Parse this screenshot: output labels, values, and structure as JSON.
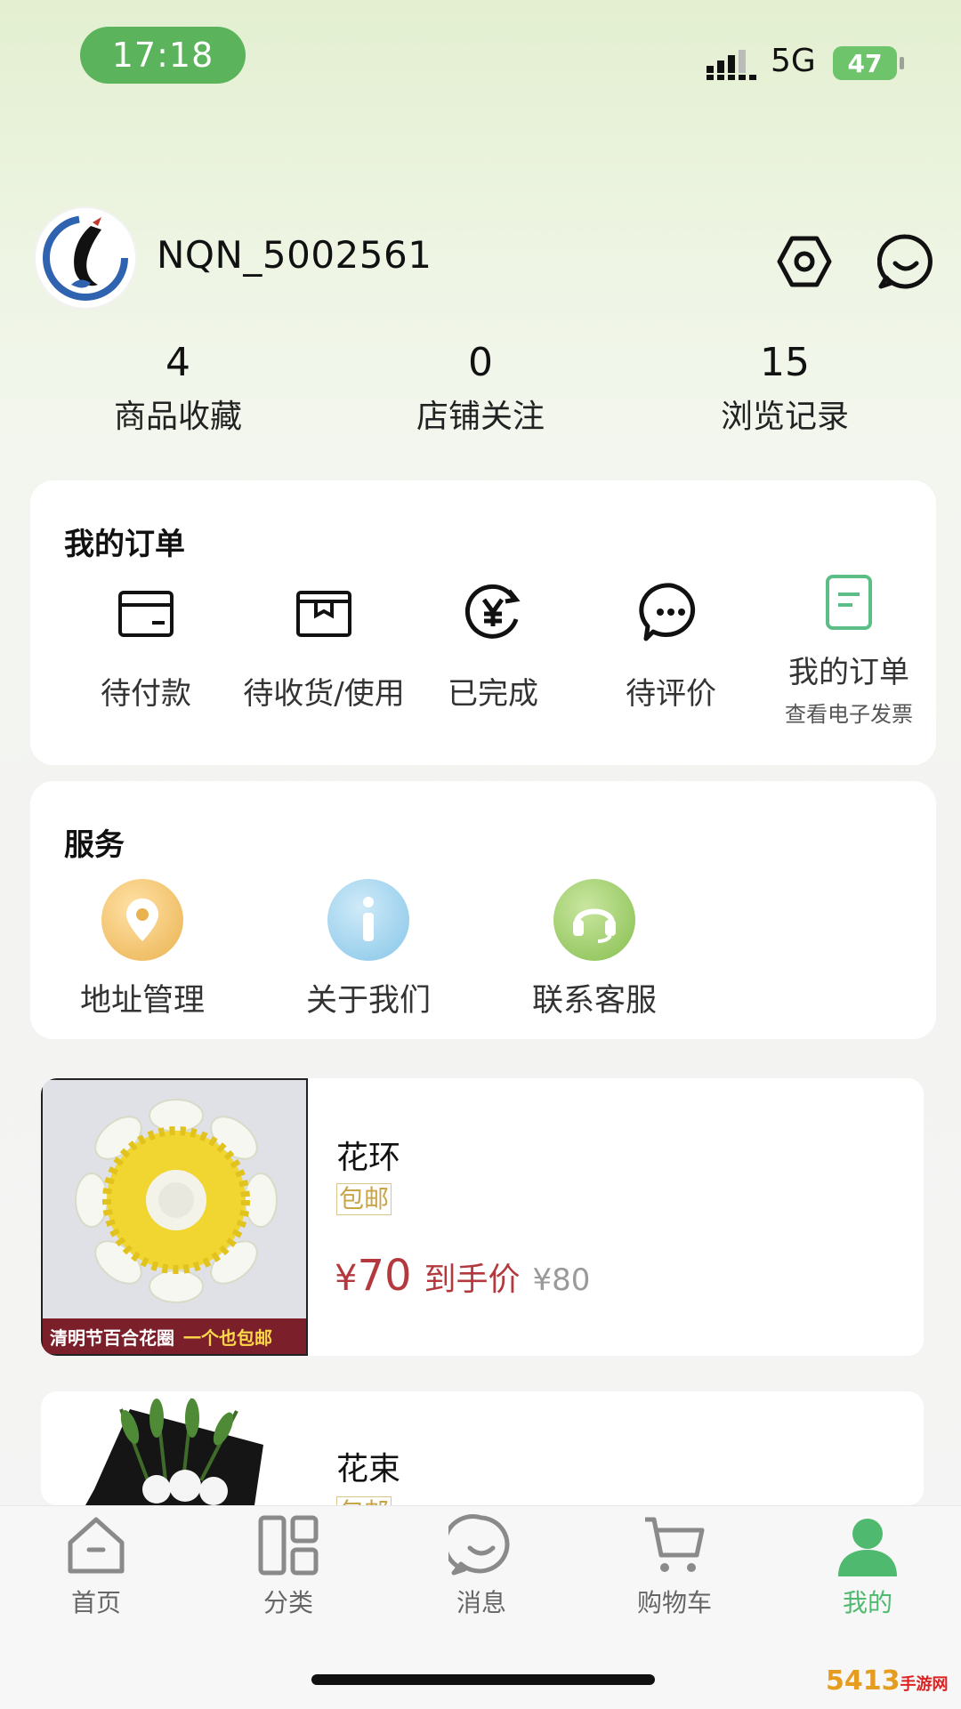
{
  "status_bar": {
    "time": "17:18",
    "network": "5G",
    "battery": "47"
  },
  "profile": {
    "username": "NQN_5002561"
  },
  "stats": [
    {
      "value": "4",
      "label": "商品收藏"
    },
    {
      "value": "0",
      "label": "店铺关注"
    },
    {
      "value": "15",
      "label": "浏览记录"
    }
  ],
  "orders": {
    "title": "我的订单",
    "items": [
      {
        "label": "待付款",
        "icon": "wallet-icon"
      },
      {
        "label": "待收货/使用",
        "icon": "package-icon"
      },
      {
        "label": "已完成",
        "icon": "yen-refresh-icon"
      },
      {
        "label": "待评价",
        "icon": "comment-icon"
      },
      {
        "label": "我的订单",
        "sub": "查看电子发票",
        "icon": "document-icon"
      }
    ]
  },
  "services": {
    "title": "服务",
    "items": [
      {
        "label": "地址管理",
        "icon": "location-pin-icon"
      },
      {
        "label": "关于我们",
        "icon": "info-icon"
      },
      {
        "label": "联系客服",
        "icon": "headset-icon"
      }
    ]
  },
  "products": [
    {
      "title": "花环",
      "tag": "包邮",
      "currency": "¥",
      "price": "70",
      "price_label": "到手价",
      "original_price": "¥80",
      "banner": "清明节百合花圈",
      "banner_highlight": "一个也包邮"
    },
    {
      "title": "花束",
      "tag": "包邮"
    }
  ],
  "tabbar": [
    {
      "label": "首页",
      "icon": "home-icon"
    },
    {
      "label": "分类",
      "icon": "category-grid-icon"
    },
    {
      "label": "消息",
      "icon": "message-icon"
    },
    {
      "label": "购物车",
      "icon": "cart-icon"
    },
    {
      "label": "我的",
      "icon": "user-icon",
      "active": true
    }
  ],
  "colors": {
    "accent": "#4fb96f",
    "price": "#b3393f",
    "tag": "#c9a54a"
  },
  "watermark": {
    "text": "5413",
    "suffix": "手游网"
  }
}
